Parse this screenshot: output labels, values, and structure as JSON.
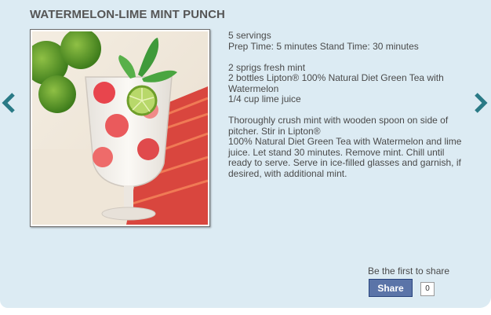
{
  "recipe": {
    "title": "WATERMELON-LIME MINT PUNCH",
    "servings": "5 servings",
    "times": "Prep Time: 5 minutes Stand Time: 30 minutes",
    "ingredients": [
      "2 sprigs fresh mint",
      "2 bottles Lipton® 100% Natural Diet Green Tea with Watermelon",
      "1/4 cup lime juice"
    ],
    "directions": [
      "Thoroughly crush mint with wooden spoon on side of pitcher. Stir in Lipton®",
      "100% Natural Diet Green Tea with Watermelon and lime juice. Let stand 30 minutes. Remove mint. Chill until ready to serve. Serve in ice-filled glasses and garnish, if desired, with additional mint."
    ]
  },
  "navigation": {
    "prev_icon": "chevron-left-icon",
    "next_icon": "chevron-right-icon",
    "arrow_color": "#2a7a86"
  },
  "share": {
    "prompt": "Be the first to share",
    "button_label": "Share",
    "count": "0"
  },
  "colors": {
    "panel_background": "#dcebf3",
    "title_text": "#555555",
    "share_button": "#5b74a8"
  }
}
